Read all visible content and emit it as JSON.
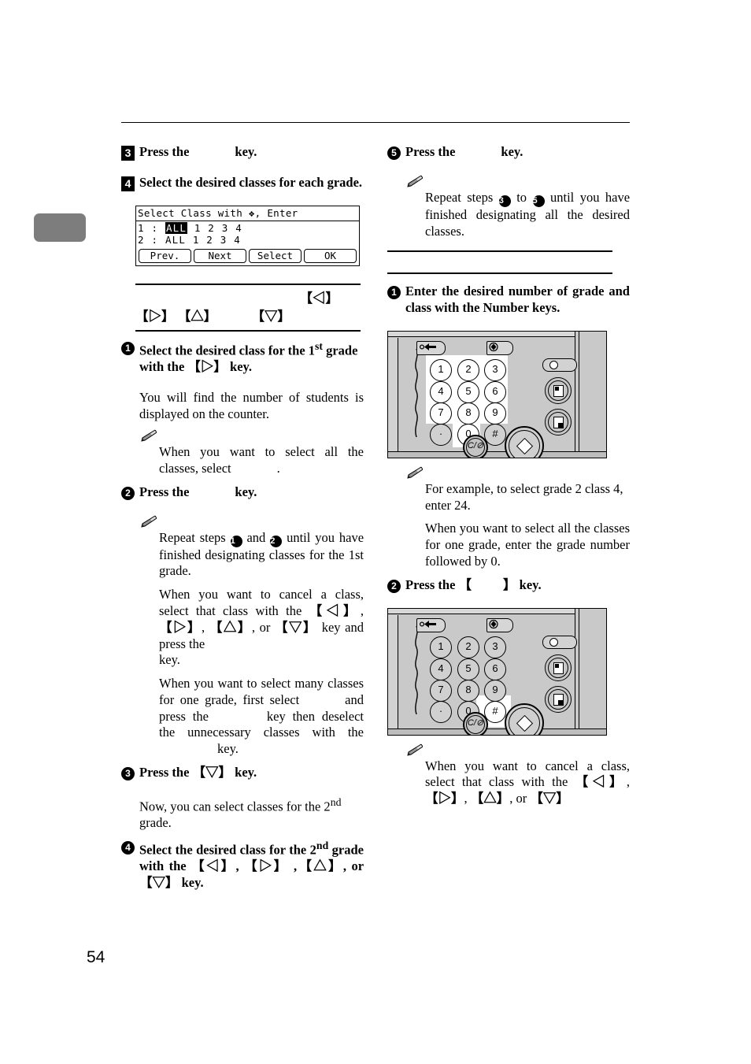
{
  "page": {
    "number": "54"
  },
  "left_column": {
    "step3": {
      "marker": "3",
      "text_before": "Press the",
      "text_after": "key."
    },
    "step4": {
      "marker": "4",
      "text": "Select the desired classes for each grade."
    },
    "lcd": {
      "title": "Select Class with ❖, Enter",
      "rows": [
        {
          "grade": "1",
          "sep": ":",
          "selected": "ALL",
          "classes": "1 2 3 4"
        },
        {
          "grade": "2",
          "sep": ":",
          "selected": "ALL",
          "classes": "1 2 3 4"
        }
      ],
      "buttons": [
        "Prev.",
        "Next",
        "Select",
        "OK"
      ]
    },
    "keybox": {
      "line1_key": "【◁】",
      "line2_keys": [
        "【▷】",
        "【△】",
        "【▽】"
      ]
    },
    "sub1": {
      "marker": "1",
      "text_part1": "Select the desired class for the 1",
      "sup": "st",
      "text_part2": " grade with the ",
      "key": "【▷】",
      "text_part3": " key.",
      "body": "You will find the number of students is displayed on the counter.",
      "note": {
        "icon": "pencil-icon",
        "text_before": "When you want to select all the classes, select",
        "text_after": "."
      }
    },
    "sub2": {
      "marker": "2",
      "text_before": "Press the",
      "text_after": "key.",
      "note": {
        "icon": "pencil-icon",
        "para1_a": "Repeat steps",
        "para1_m1": "1",
        "para1_b": "and",
        "para1_m2": "2",
        "para1_c": "until you have finished designating classes for the 1st grade.",
        "para2_a": "When you want to cancel a class, select that class with the",
        "para2_keys": [
          "【◁】",
          "【▷】",
          "【△】",
          "【▽】"
        ],
        "para2_or": "or",
        "para2_b": "key and press the",
        "para2_c": "key.",
        "para3_a": "When you want to select many classes for one grade, first select",
        "para3_b": "and press the",
        "para3_c": "key then deselect the unnecessary classes with the",
        "para3_d": "key."
      }
    },
    "sub3": {
      "marker": "3",
      "text_before": "Press the ",
      "key": "【▽】",
      "text_after": " key.",
      "body_a": "Now, you can select classes for the 2",
      "body_sup": "nd",
      "body_b": " grade."
    },
    "sub4": {
      "marker": "4",
      "text_a": "Select the desired class for the 2",
      "sup": "nd",
      "text_b": " grade with the ",
      "keys": [
        "【◁】",
        "【▷】",
        "【△】",
        "【▽】"
      ],
      "text_c": " ,",
      "text_or": ", or ",
      "text_d": " key."
    }
  },
  "right_column": {
    "step5": {
      "marker": "5",
      "text_before": "Press the",
      "text_after": "key.",
      "note": {
        "icon": "pencil-icon",
        "text_a": "Repeat steps",
        "marker_from": "3",
        "text_b": "to",
        "marker_to": "5",
        "text_c": "until you have finished designating all the desired classes."
      }
    },
    "sub1": {
      "marker": "1",
      "text": "Enter the desired number of grade and class with the Number keys."
    },
    "panel1": {
      "name": "control-panel-numberkeys",
      "keys": [
        "1",
        "2",
        "3",
        "4",
        "5",
        "6",
        "7",
        "8",
        "9",
        "·",
        "0",
        "#"
      ],
      "clear_key": "C/⊘",
      "highlight": "number-keys"
    },
    "note1": {
      "icon": "pencil-icon",
      "para1": "For example, to select grade 2 class 4, enter 24.",
      "para2": "When you want to select all the classes for one grade, enter the grade number followed by 0."
    },
    "sub2": {
      "marker": "2",
      "text_before": "Press the 【",
      "text_after": "】 key."
    },
    "panel2": {
      "name": "control-panel-hashkey",
      "keys": [
        "1",
        "2",
        "3",
        "4",
        "5",
        "6",
        "7",
        "8",
        "9",
        "·",
        "0",
        "#"
      ],
      "clear_key": "C/⊘",
      "highlight": "hash-key"
    },
    "note2": {
      "icon": "pencil-icon",
      "text_a": "When you want to cancel a class, select that class with the",
      "keys": [
        "【◁】",
        "【▷】",
        "【△】",
        "【▽】"
      ],
      "text_or": "or"
    }
  }
}
